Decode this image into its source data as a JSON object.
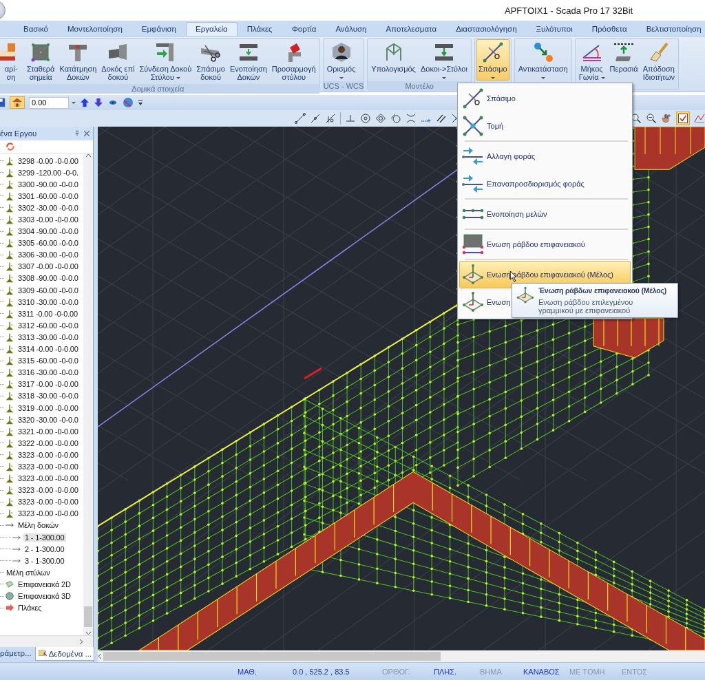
{
  "window": {
    "title": "APFTOIX1 - Scada Pro 17 32Bit"
  },
  "ribbon": {
    "tabs": [
      {
        "label": "Βασικό",
        "selected": false
      },
      {
        "label": "Μοντελοποίηση",
        "selected": false
      },
      {
        "label": "Εμφάνιση",
        "selected": false
      },
      {
        "label": "Εργαλεία",
        "selected": true
      },
      {
        "label": "Πλάκες",
        "selected": false
      },
      {
        "label": "Φορτία",
        "selected": false
      },
      {
        "label": "Ανάλυση",
        "selected": false
      },
      {
        "label": "Αποτελεσματα",
        "selected": false
      },
      {
        "label": "Διαστασιολόγηση",
        "selected": false
      },
      {
        "label": "Ξυλότυποι",
        "selected": false
      },
      {
        "label": "Πρόσθετα",
        "selected": false
      },
      {
        "label": "Βελτιστοποίηση",
        "selected": false
      }
    ],
    "groups": [
      {
        "label": "Δομικά στοιχεία",
        "buttons": [
          {
            "label": "αρί-\nση",
            "dropdown": false,
            "pressed": false
          },
          {
            "label": "Σταθερά\nσημεία",
            "dropdown": false,
            "pressed": false
          },
          {
            "label": "Κατάτμηση\nΔοκών",
            "dropdown": false,
            "pressed": false
          },
          {
            "label": "Δοκός επί\nδοκού",
            "dropdown": false,
            "pressed": false
          },
          {
            "label": "Σύνδεση Δοκού\nΣτύλου",
            "dropdown": true,
            "pressed": false
          },
          {
            "label": "Σπάσιμο\nδοκού",
            "dropdown": false,
            "pressed": false
          },
          {
            "label": "Ενοποίηση\nΔοκών",
            "dropdown": false,
            "pressed": false
          },
          {
            "label": "Προσαρμογή\nστύλου",
            "dropdown": false,
            "pressed": false
          }
        ]
      },
      {
        "label": "UCS - WCS",
        "buttons": [
          {
            "label": "Ορισμός",
            "dropdown": true,
            "pressed": false
          }
        ]
      },
      {
        "label": "Μοντέλο",
        "buttons": [
          {
            "label": "Υπολογισμός",
            "dropdown": false,
            "pressed": false
          },
          {
            "label": "Δοκοι->Στύλοι",
            "dropdown": true,
            "pressed": false
          }
        ]
      },
      {
        "buttons": [
          {
            "label": "Σπάσιμο",
            "dropdown": true,
            "pressed": true
          }
        ]
      },
      {
        "buttons": [
          {
            "label": "Αντικατάσταση",
            "dropdown": true,
            "pressed": false
          }
        ]
      },
      {
        "buttons": [
          {
            "label": "Μήκος\nΓωνία",
            "dropdown": true,
            "pressed": false
          },
          {
            "label": "Περασιά",
            "dropdown": false,
            "pressed": false
          },
          {
            "label": "Απόδοση\nΙδιοτήτων",
            "dropdown": false,
            "pressed": false
          }
        ]
      }
    ]
  },
  "quick_toolbar": {
    "level_field": {
      "value": "0.00"
    },
    "house_view_on": true
  },
  "snap_toolbar": {
    "grid_check_on": true
  },
  "side_panel": {
    "title": "ένα Εργου",
    "tree": [
      {
        "label": "3298 -0.00 -0-0.00",
        "kind": "node"
      },
      {
        "label": "3299 -120.00 -0-0.",
        "kind": "node"
      },
      {
        "label": "3300 -90.00 -0-0.0",
        "kind": "node"
      },
      {
        "label": "3301 -60.00 -0-0.0",
        "kind": "node"
      },
      {
        "label": "3302 -30.00 -0-0.0",
        "kind": "node"
      },
      {
        "label": "3303 -0.00 -0-0.00",
        "kind": "node"
      },
      {
        "label": "3304 -90.00 -0-0.0",
        "kind": "node"
      },
      {
        "label": "3305 -60.00 -0-0.0",
        "kind": "node"
      },
      {
        "label": "3306 -30.00 -0-0.0",
        "kind": "node"
      },
      {
        "label": "3307 -0.00 -0-0.00",
        "kind": "node"
      },
      {
        "label": "3308 -90.00 -0-0.0",
        "kind": "node"
      },
      {
        "label": "3309 -60.00 -0-0.0",
        "kind": "node"
      },
      {
        "label": "3310 -30.00 -0-0.0",
        "kind": "node"
      },
      {
        "label": "3311 -0.00 -0-0.00",
        "kind": "node"
      },
      {
        "label": "3312 -60.00 -0-0.0",
        "kind": "node"
      },
      {
        "label": "3313 -30.00 -0-0.0",
        "kind": "node"
      },
      {
        "label": "3314 -0.00 -0-0.00",
        "kind": "node"
      },
      {
        "label": "3315 -60.00 -0-0.0",
        "kind": "node"
      },
      {
        "label": "3316 -30.00 -0-0.0",
        "kind": "node"
      },
      {
        "label": "3317 -0.00 -0-0.00",
        "kind": "node"
      },
      {
        "label": "3318 -30.00 -0-0.0",
        "kind": "node"
      },
      {
        "label": "3319 -0.00 -0-0.00",
        "kind": "node"
      },
      {
        "label": "3320 -30.00 -0-0.0",
        "kind": "node"
      },
      {
        "label": "3321 -0.00 -0-0.00",
        "kind": "node"
      },
      {
        "label": "3322 -0.00 -0-0.00",
        "kind": "node"
      },
      {
        "label": "3323 -0.00 -0-0.00",
        "kind": "node"
      },
      {
        "label": "3323 -0.00 -0-0.00",
        "kind": "node"
      },
      {
        "label": "3323 -0.00 -0-0.00",
        "kind": "node"
      },
      {
        "label": "3323 -0.00 -0-0.00",
        "kind": "node"
      },
      {
        "label": "3323 -0.00 -0-0.00",
        "kind": "node"
      },
      {
        "label": "3323 -0.00 -0-0.00",
        "kind": "node"
      },
      {
        "label": "Μέλη δοκών",
        "kind": "beam-group",
        "children": [
          {
            "label": "1 - 1-300.00",
            "kind": "member",
            "selected": true
          },
          {
            "label": "2 - 1-300.00",
            "kind": "member",
            "selected": false
          },
          {
            "label": "3 - 1-300.00",
            "kind": "member",
            "selected": false
          }
        ]
      },
      {
        "label": "Μέλη στύλων",
        "kind": "column-group"
      },
      {
        "label": "Επιφανειακά 2D",
        "kind": "surface-2d"
      },
      {
        "label": "Επιφανειακά 3D",
        "kind": "surface-3d"
      },
      {
        "label": "Πλάκες",
        "kind": "slab-group"
      }
    ],
    "tabs": [
      {
        "label": "ράμετρ...",
        "selected": false
      },
      {
        "label": "Δεδομένα ...",
        "selected": true
      }
    ]
  },
  "menu": {
    "items": [
      {
        "label": "Σπάσιμο",
        "selected": false,
        "divider_above": false
      },
      {
        "label": "Τομή",
        "selected": false,
        "divider_above": false
      },
      {
        "label": "Αλλαγή φοράς",
        "selected": false,
        "divider_above": true
      },
      {
        "label": "Επαναπροσδιορισμός φοράς",
        "selected": false,
        "divider_above": false
      },
      {
        "label": "Ενοποίηση μελών",
        "selected": false,
        "divider_above": true
      },
      {
        "label": "Ενωση ράβδου επιφανειακού",
        "selected": false,
        "divider_above": true
      },
      {
        "label": "Ενωση ράβδου επιφανειακού (Μέλος)",
        "selected": true,
        "divider_above": true
      },
      {
        "label": "Ενωση",
        "selected": false,
        "divider_above": false
      }
    ]
  },
  "tooltip": {
    "title": "Ένωση ράβδων επιφανειακού (Μέλος)",
    "text": "Ενωση ράβδου επιλεγμένου γραμμικού με επιφανειακού"
  },
  "status_bar": {
    "items": [
      {
        "kind": "toggle",
        "label": "ΜΑΘ.",
        "on": true
      },
      {
        "kind": "readout",
        "label": "0.0 , 525.2 , 83.5"
      },
      {
        "kind": "toggle",
        "label": "ΟΡΘΟΓ.",
        "on": false
      },
      {
        "kind": "toggle",
        "label": "ΠΛΗΣ.",
        "on": true
      },
      {
        "kind": "toggle",
        "label": "ΒΗΜΑ",
        "on": false
      },
      {
        "kind": "toggle",
        "label": "ΚΑΝΑΒΟΣ",
        "on": true
      },
      {
        "kind": "toggle",
        "label": "ΜΕ ΤΟΜΗ",
        "on": false
      },
      {
        "kind": "toggle",
        "label": "ΕΝΤΟΣ",
        "on": false
      }
    ]
  }
}
